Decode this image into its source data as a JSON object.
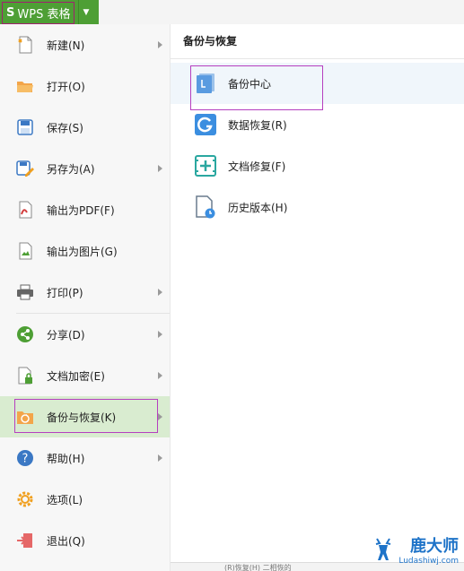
{
  "app": {
    "logo": "S",
    "title": "WPS 表格"
  },
  "menu": {
    "items": [
      {
        "id": "new",
        "label": "新建(N)",
        "has_sub": true
      },
      {
        "id": "open",
        "label": "打开(O)",
        "has_sub": false
      },
      {
        "id": "save",
        "label": "保存(S)",
        "has_sub": false
      },
      {
        "id": "save-as",
        "label": "另存为(A)",
        "has_sub": true
      },
      {
        "id": "export-pdf",
        "label": "输出为PDF(F)",
        "has_sub": false
      },
      {
        "id": "export-image",
        "label": "输出为图片(G)",
        "has_sub": false
      },
      {
        "id": "print",
        "label": "打印(P)",
        "has_sub": true
      },
      {
        "id": "share",
        "label": "分享(D)",
        "has_sub": true
      },
      {
        "id": "encrypt",
        "label": "文档加密(E)",
        "has_sub": true
      },
      {
        "id": "backup",
        "label": "备份与恢复(K)",
        "has_sub": true
      },
      {
        "id": "help",
        "label": "帮助(H)",
        "has_sub": true
      },
      {
        "id": "options",
        "label": "选项(L)",
        "has_sub": false
      },
      {
        "id": "exit",
        "label": "退出(Q)",
        "has_sub": false
      }
    ]
  },
  "panel": {
    "title": "备份与恢复",
    "items": [
      {
        "id": "backup-center",
        "label": "备份中心"
      },
      {
        "id": "data-recovery",
        "label": "数据恢复(R)"
      },
      {
        "id": "doc-repair",
        "label": "文档修复(F)"
      },
      {
        "id": "history",
        "label": "历史版本(H)"
      }
    ]
  },
  "bottom": {
    "text": "(R)恢复(H)  二相恢的"
  },
  "watermark": {
    "title": "鹿大师",
    "url": "Ludashiwj.com"
  },
  "colors": {
    "accent": "#4e9f35",
    "highlight": "#b63fbf",
    "active_bg": "#d9ecd0"
  }
}
